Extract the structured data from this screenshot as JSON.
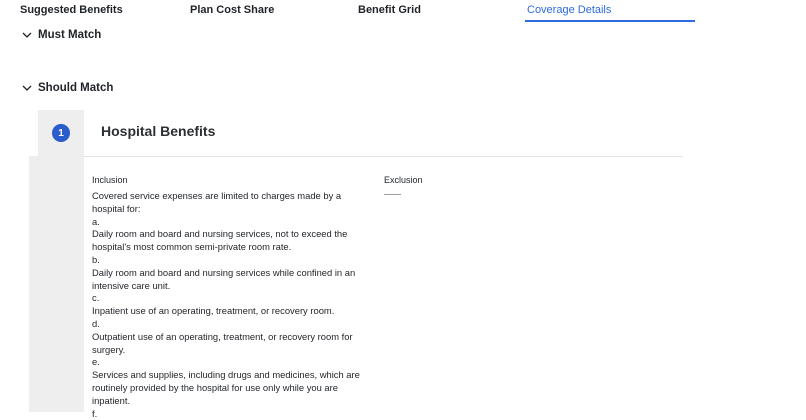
{
  "tabs": [
    {
      "label": "Suggested Benefits",
      "active": false
    },
    {
      "label": "Plan Cost Share",
      "active": false
    },
    {
      "label": "Benefit Grid",
      "active": false
    },
    {
      "label": "Coverage Details",
      "active": true
    }
  ],
  "colors": {
    "accent": "#2f6ae0",
    "badge": "#2a5ccc",
    "rail": "#eeeeee"
  },
  "sections": {
    "must_match": {
      "label": "Must Match",
      "icon": "chevron-down-icon"
    },
    "should_match": {
      "label": "Should Match",
      "icon": "chevron-down-icon"
    }
  },
  "benefit": {
    "number": "1",
    "title": "Hospital Benefits",
    "inclusion_label": "Inclusion",
    "exclusion_label": "Exclusion",
    "exclusion_value": "——",
    "inclusion_lines": [
      "Covered service expenses are limited to charges made by a hospital for:",
      "a.",
      "Daily room and board and nursing services, not to exceed the hospital's most common semi-private room rate.",
      "b.",
      "Daily room and board and nursing services while confined in an intensive care unit.",
      "c.",
      "Inpatient use of an operating, treatment, or recovery room.",
      "d.",
      "Outpatient use of an operating, treatment, or recovery room for surgery.",
      "e.",
      "Services and supplies, including drugs and medicines, which are routinely provided by the hospital for use only while you are inpatient.",
      "f."
    ]
  }
}
